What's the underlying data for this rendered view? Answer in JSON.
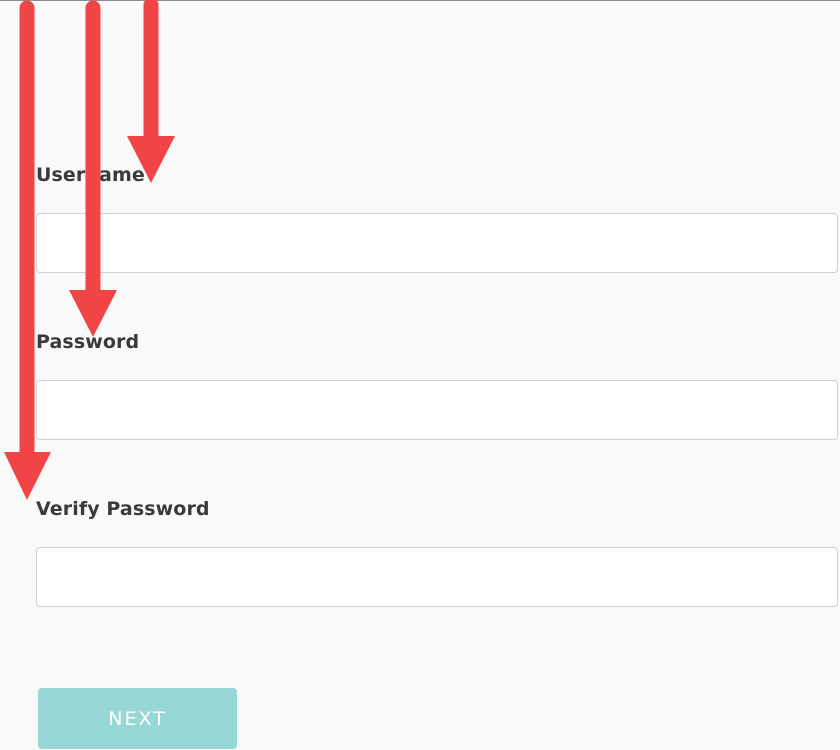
{
  "form": {
    "username_label": "Username",
    "username_value": "",
    "password_label": "Password",
    "password_value": "",
    "verify_password_label": "Verify Password",
    "verify_password_value": "",
    "next_label": "NEXT"
  },
  "colors": {
    "page_background": "#f9f9f9",
    "input_border": "#cfcfcf",
    "button_background": "#97d8d6",
    "button_text": "#ffffff",
    "label_text": "#3a3a3a",
    "arrow_red": "#f04447"
  },
  "annotations": {
    "arrows": [
      "arrow-down-icon",
      "arrow-down-icon",
      "arrow-down-icon"
    ]
  }
}
